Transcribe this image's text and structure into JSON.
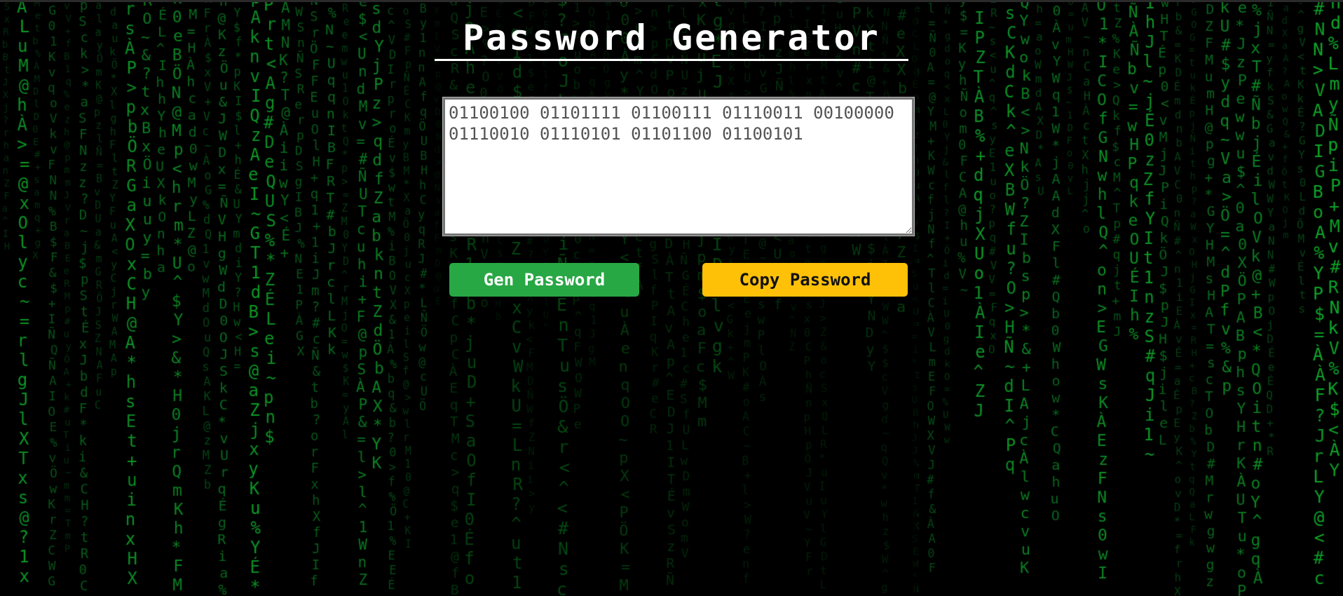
{
  "page": {
    "title": "Password Generator"
  },
  "output": {
    "value": "01100100 01101111 01100111 01110011 00100000 01110010 01110101 01101100 01100101"
  },
  "buttons": {
    "generate_label": "Gen Password",
    "copy_label": "Copy Password"
  },
  "colors": {
    "generate_button": "#28a745",
    "copy_button": "#ffc107",
    "background": "#000000",
    "matrix_green": "#1fd14a"
  }
}
